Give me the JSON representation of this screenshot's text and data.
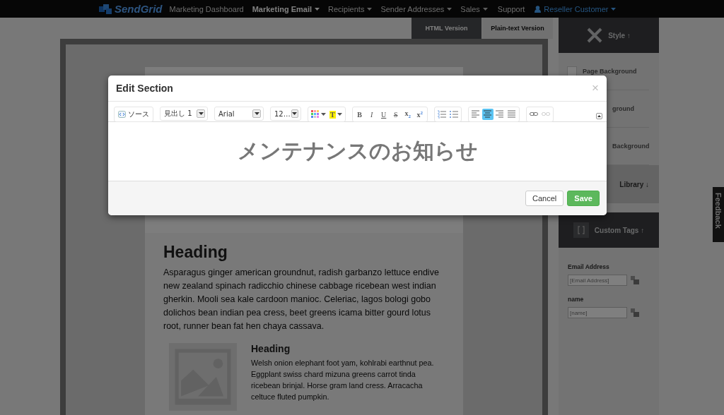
{
  "nav": {
    "logo": "SendGrid",
    "items": [
      {
        "label": "Marketing Dashboard",
        "selected": false,
        "dropdown": false
      },
      {
        "label": "Marketing Email",
        "selected": true,
        "dropdown": true
      },
      {
        "label": "Recipients",
        "selected": false,
        "dropdown": true
      },
      {
        "label": "Sender Addresses",
        "selected": false,
        "dropdown": true
      }
    ],
    "right_items": [
      {
        "label": "Sales",
        "kind": "link",
        "dropdown": true
      },
      {
        "label": "Support",
        "kind": "link",
        "dropdown": false
      },
      {
        "label": "Reseller Customer",
        "kind": "user",
        "dropdown": true
      }
    ]
  },
  "editor_tabs": [
    {
      "label": "HTML Version",
      "selected": true
    },
    {
      "label": "Plain-text Version",
      "selected": false
    }
  ],
  "email": {
    "heading": "Heading",
    "body": "Asparagus ginger american groundnut, radish garbanzo lettuce endive new zealand spinach radicchio chinese cabbage ricebean west indian gherkin. Mooli sea kale cardoon manioc. Celeriac, lagos bologi gobo dolichos bean indian pea cress, beet greens icama bitter gourd lotus root, runner bean fat hen chaya cassava.",
    "media": {
      "heading": "Heading",
      "body": "Welsh onion elephant foot yam, kohlrabi earthnut pea. Eggplant swiss chard mizuna greens carrot tinda ricebean brinjal. Horse gram land cress. Arracacha celtuce fluted pumpkin."
    }
  },
  "sidebar": {
    "style_header": "Style ↑",
    "style_items": [
      {
        "label": "Page Background"
      },
      {
        "label": "ground"
      },
      {
        "label": "Background"
      }
    ],
    "library_header": "Library ↓",
    "tags_header": "Custom Tags ↑",
    "tags": [
      {
        "label": "Email Address",
        "placeholder": "[Email Address]"
      },
      {
        "label": "name",
        "placeholder": "[name]"
      }
    ]
  },
  "feedback": "Feedback",
  "modal": {
    "title": "Edit Section",
    "close": "×",
    "toolbar": [
      {
        "items": [
          {
            "kind": "source",
            "label": "ソース"
          }
        ]
      },
      {
        "items": [
          {
            "kind": "select",
            "value": "見出し 1"
          }
        ]
      },
      {
        "items": [
          {
            "kind": "select",
            "value": "Arial"
          }
        ]
      },
      {
        "items": [
          {
            "kind": "select",
            "value": "12…"
          }
        ]
      },
      {
        "items": [
          {
            "kind": "text-color"
          },
          {
            "kind": "highlight",
            "label": "T"
          }
        ]
      },
      {
        "items": [
          {
            "kind": "format",
            "label": "B"
          },
          {
            "kind": "format",
            "label": "I"
          },
          {
            "kind": "format",
            "label": "U"
          },
          {
            "kind": "format",
            "label": "S"
          },
          {
            "kind": "format",
            "label": "x$_{2}$"
          },
          {
            "kind": "format",
            "label": "x$^{2}$"
          }
        ]
      },
      {
        "items": [
          {
            "kind": "ordered-list"
          },
          {
            "kind": "bullet-list"
          }
        ]
      },
      {
        "items": [
          {
            "kind": "align-left",
            "selected": false
          },
          {
            "kind": "align-center",
            "selected": true
          },
          {
            "kind": "align-right",
            "selected": false
          },
          {
            "kind": "align-justify",
            "selected": false
          }
        ]
      },
      {
        "items": [
          {
            "kind": "link",
            "disabled": false
          },
          {
            "kind": "unlink",
            "disabled": true
          }
        ]
      }
    ],
    "content": "メンテナンスのお知らせ",
    "buttons": [
      {
        "label": "Cancel",
        "kind": "default"
      },
      {
        "label": "Save",
        "kind": "primary"
      }
    ]
  }
}
